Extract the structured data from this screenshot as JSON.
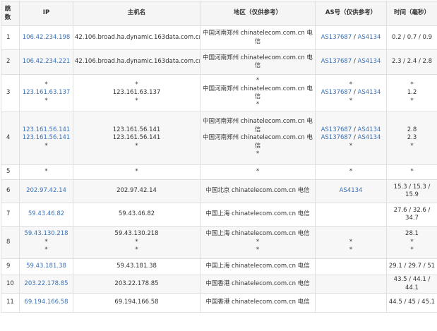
{
  "headers": {
    "hop": "跳数",
    "ip": "IP",
    "host": "主机名",
    "region": "地区（仅供参考）",
    "asn": "AS号（仅供参考）",
    "time": "时间（毫秒）"
  },
  "rows": [
    {
      "hop": "1",
      "ip": [
        "106.42.234.198"
      ],
      "host": [
        "42.106.broad.ha.dynamic.163data.com.cn"
      ],
      "region": [
        "中国河南郑州 chinatelecom.com.cn 电",
        "信"
      ],
      "asn": [
        [
          "AS137687",
          "AS4134"
        ]
      ],
      "time": [
        "0.2 / 0.7 / 0.9"
      ]
    },
    {
      "hop": "2",
      "ip": [
        "106.42.234.221"
      ],
      "host": [
        "42.106.broad.ha.dynamic.163data.com.cn"
      ],
      "region": [
        "中国河南郑州 chinatelecom.com.cn 电",
        "信"
      ],
      "asn": [
        [
          "AS137687",
          "AS4134"
        ]
      ],
      "time": [
        "2.3 / 2.4 / 2.8"
      ]
    },
    {
      "hop": "3",
      "ip": [
        "*",
        "123.161.63.137",
        "*"
      ],
      "host": [
        "*",
        "123.161.63.137",
        "*"
      ],
      "region": [
        "*",
        "中国河南郑州 chinatelecom.com.cn 电",
        "信",
        "*"
      ],
      "asn": [
        [
          "*"
        ],
        [
          "AS137687",
          "AS4134"
        ],
        [
          "*"
        ]
      ],
      "time": [
        "*",
        "1.2",
        "*"
      ]
    },
    {
      "hop": "4",
      "ip": [
        "123.161.56.141",
        "123.161.56.141",
        "*"
      ],
      "host": [
        "123.161.56.141",
        "123.161.56.141",
        "*"
      ],
      "region": [
        "中国河南郑州 chinatelecom.com.cn 电",
        "信",
        "中国河南郑州 chinatelecom.com.cn 电",
        "信",
        "*"
      ],
      "asn": [
        [
          "AS137687",
          "AS4134"
        ],
        [
          "AS137687",
          "AS4134"
        ],
        [
          "*"
        ]
      ],
      "time": [
        "2.8",
        "2.3",
        "*"
      ]
    },
    {
      "hop": "5",
      "ip": [
        "*"
      ],
      "host": [
        "*"
      ],
      "region": [
        "*"
      ],
      "asn": [
        [
          "*"
        ]
      ],
      "time": [
        "*"
      ]
    },
    {
      "hop": "6",
      "ip": [
        "202.97.42.14"
      ],
      "host": [
        "202.97.42.14"
      ],
      "region": [
        "中国北京 chinatelecom.com.cn 电信"
      ],
      "asn": [
        [
          "AS4134"
        ]
      ],
      "time": [
        "15.3 / 15.3 /",
        "15.9"
      ]
    },
    {
      "hop": "7",
      "ip": [
        "59.43.46.82"
      ],
      "host": [
        "59.43.46.82"
      ],
      "region": [
        "中国上海 chinatelecom.com.cn 电信"
      ],
      "asn": [],
      "time": [
        "27.6 / 32.6 /",
        "34.7"
      ]
    },
    {
      "hop": "8",
      "ip": [
        "59.43.130.218",
        "*",
        "*"
      ],
      "host": [
        "59.43.130.218",
        "*",
        "*"
      ],
      "region": [
        "中国上海 chinatelecom.com.cn 电信",
        "*",
        "*"
      ],
      "asn": [
        [
          ""
        ],
        [
          "*"
        ],
        [
          "*"
        ]
      ],
      "time": [
        "28.1",
        "*",
        "*"
      ]
    },
    {
      "hop": "9",
      "ip": [
        "59.43.181.38"
      ],
      "host": [
        "59.43.181.38"
      ],
      "region": [
        "中国上海 chinatelecom.com.cn 电信"
      ],
      "asn": [],
      "time": [
        "29.1 / 29.7 / 51"
      ]
    },
    {
      "hop": "10",
      "ip": [
        "203.22.178.85"
      ],
      "host": [
        "203.22.178.85"
      ],
      "region": [
        "中国香港 chinatelecom.com.cn 电信"
      ],
      "asn": [],
      "time": [
        "43.5 / 44.1 /",
        "44.1"
      ]
    },
    {
      "hop": "11",
      "ip": [
        "69.194.166.58"
      ],
      "host": [
        "69.194.166.58"
      ],
      "region": [
        "中国香港 chinatelecom.com.cn 电信"
      ],
      "asn": [],
      "time": [
        "44.5 / 45 / 45.1"
      ]
    }
  ]
}
